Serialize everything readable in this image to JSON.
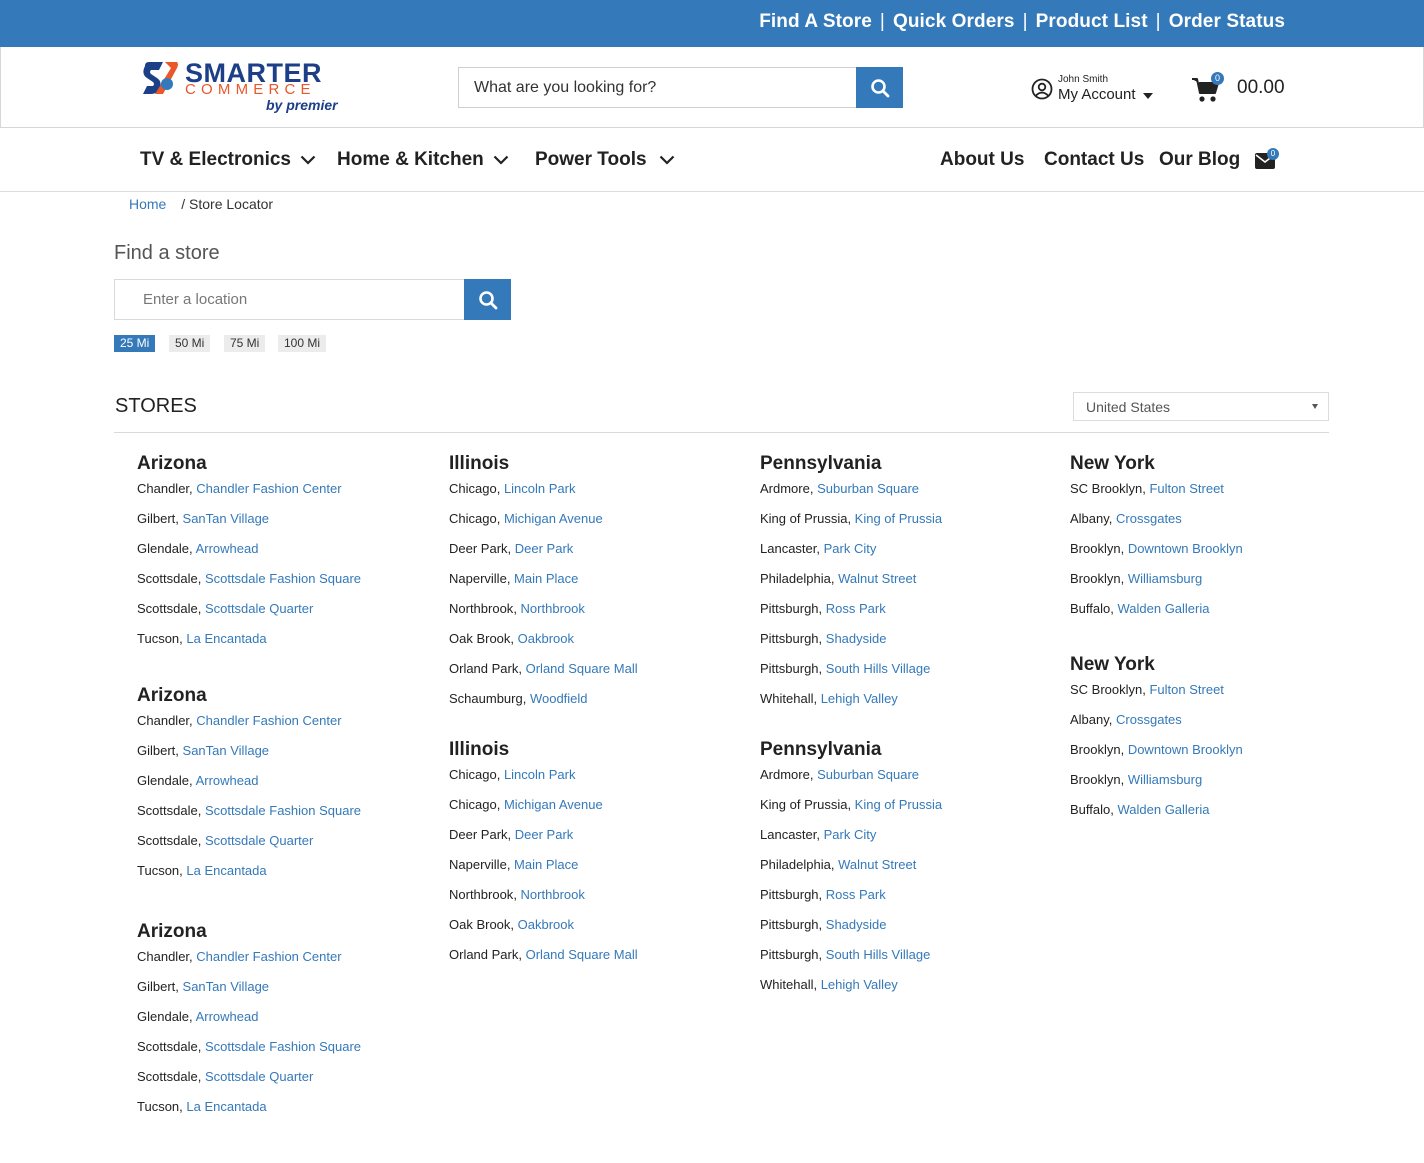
{
  "topbar": {
    "links": [
      "Find A Store",
      "Quick Orders",
      "Product List",
      "Order Status"
    ],
    "separator": "|"
  },
  "logo": {
    "word1": "SMARTER",
    "word2": "COMMERCE",
    "word3": "by premier"
  },
  "search": {
    "placeholder": "What are you looking for?"
  },
  "account": {
    "user_name": "John Smith",
    "label": "My Account"
  },
  "cart": {
    "count": "0",
    "total": "00.00"
  },
  "nav": {
    "menus": [
      "TV & Electronics",
      "Home & Kitchen",
      "Power Tools"
    ],
    "links": [
      "About Us",
      "Contact Us",
      "Our Blog"
    ],
    "mail_badge": "0"
  },
  "breadcrumb": {
    "home": "Home",
    "current": "/ Store Locator"
  },
  "finder": {
    "title": "Find a store",
    "placeholder": "Enter a location",
    "radii": [
      "25 Mi",
      "50 Mi",
      "75 Mi",
      "100 Mi"
    ],
    "active_radius": "25 Mi"
  },
  "stores": {
    "title": "STORES",
    "country": "United States",
    "groups": [
      {
        "state": "Arizona",
        "stores": [
          {
            "city": "Chandler",
            "name": "Chandler Fashion Center"
          },
          {
            "city": "Gilbert",
            "name": "SanTan Village"
          },
          {
            "city": "Glendale",
            "name": "Arrowhead"
          },
          {
            "city": "Scottsdale",
            "name": "Scottsdale Fashion Square"
          },
          {
            "city": "Scottsdale",
            "name": "Scottsdale Quarter"
          },
          {
            "city": "Tucson",
            "name": "La Encantada"
          }
        ]
      },
      {
        "state": "Arizona",
        "stores": [
          {
            "city": "Chandler",
            "name": "Chandler Fashion Center"
          },
          {
            "city": "Gilbert",
            "name": "SanTan Village"
          },
          {
            "city": "Glendale",
            "name": "Arrowhead"
          },
          {
            "city": "Scottsdale",
            "name": "Scottsdale Fashion Square"
          },
          {
            "city": "Scottsdale",
            "name": "Scottsdale Quarter"
          },
          {
            "city": "Tucson",
            "name": "La Encantada"
          }
        ]
      },
      {
        "state": "Arizona",
        "stores": [
          {
            "city": "Chandler",
            "name": "Chandler Fashion Center"
          },
          {
            "city": "Gilbert",
            "name": "SanTan Village"
          },
          {
            "city": "Glendale",
            "name": "Arrowhead"
          },
          {
            "city": "Scottsdale",
            "name": "Scottsdale Fashion Square"
          },
          {
            "city": "Scottsdale",
            "name": "Scottsdale Quarter"
          },
          {
            "city": "Tucson",
            "name": "La Encantada"
          }
        ]
      },
      {
        "state": "Illinois",
        "stores": [
          {
            "city": "Chicago",
            "name": "Lincoln Park"
          },
          {
            "city": "Chicago",
            "name": "Michigan Avenue"
          },
          {
            "city": "Deer Park",
            "name": "Deer Park"
          },
          {
            "city": "Naperville",
            "name": "Main Place"
          },
          {
            "city": "Northbrook",
            "name": "Northbrook"
          },
          {
            "city": "Oak Brook",
            "name": "Oakbrook"
          },
          {
            "city": "Orland Park",
            "name": "Orland Square Mall"
          },
          {
            "city": "Schaumburg",
            "name": "Woodfield"
          }
        ]
      },
      {
        "state": "Illinois",
        "stores": [
          {
            "city": "Chicago",
            "name": "Lincoln Park"
          },
          {
            "city": "Chicago",
            "name": "Michigan Avenue"
          },
          {
            "city": "Deer Park",
            "name": "Deer Park"
          },
          {
            "city": "Naperville",
            "name": "Main Place"
          },
          {
            "city": "Northbrook",
            "name": "Northbrook"
          },
          {
            "city": "Oak Brook",
            "name": "Oakbrook"
          },
          {
            "city": "Orland Park",
            "name": "Orland Square Mall"
          }
        ]
      },
      {
        "state": "Pennsylvania",
        "stores": [
          {
            "city": "Ardmore",
            "name": "Suburban Square"
          },
          {
            "city": "King of Prussia",
            "name": "King of Prussia"
          },
          {
            "city": "Lancaster",
            "name": "Park City"
          },
          {
            "city": "Philadelphia",
            "name": "Walnut Street"
          },
          {
            "city": "Pittsburgh",
            "name": "Ross Park"
          },
          {
            "city": "Pittsburgh",
            "name": "Shadyside"
          },
          {
            "city": "Pittsburgh",
            "name": "South Hills Village"
          },
          {
            "city": "Whitehall",
            "name": "Lehigh Valley"
          }
        ]
      },
      {
        "state": "Pennsylvania",
        "stores": [
          {
            "city": "Ardmore",
            "name": "Suburban Square"
          },
          {
            "city": "King of Prussia",
            "name": "King of Prussia"
          },
          {
            "city": "Lancaster",
            "name": "Park City"
          },
          {
            "city": "Philadelphia",
            "name": "Walnut Street"
          },
          {
            "city": "Pittsburgh",
            "name": "Ross Park"
          },
          {
            "city": "Pittsburgh",
            "name": "Shadyside"
          },
          {
            "city": "Pittsburgh",
            "name": "South Hills Village"
          },
          {
            "city": "Whitehall",
            "name": "Lehigh Valley"
          }
        ]
      },
      {
        "state": "New York",
        "stores": [
          {
            "city": "SC Brooklyn",
            "name": "Fulton Street"
          },
          {
            "city": "Albany",
            "name": "Crossgates"
          },
          {
            "city": "Brooklyn",
            "name": "Downtown Brooklyn"
          },
          {
            "city": "Brooklyn",
            "name": "Williamsburg"
          },
          {
            "city": "Buffalo",
            "name": "Walden Galleria"
          }
        ]
      },
      {
        "state": "New York",
        "stores": [
          {
            "city": "SC Brooklyn",
            "name": "Fulton Street"
          },
          {
            "city": "Albany",
            "name": "Crossgates"
          },
          {
            "city": "Brooklyn",
            "name": "Downtown Brooklyn"
          },
          {
            "city": "Brooklyn",
            "name": "Williamsburg"
          },
          {
            "city": "Buffalo",
            "name": "Walden Galleria"
          }
        ]
      }
    ]
  },
  "colors": {
    "brand": "#3479b9",
    "logo_navy": "#1c3f87",
    "logo_orange": "#e9572a"
  },
  "icons": [
    "search-icon",
    "user-circle-icon",
    "caret-down-icon",
    "cart-icon",
    "chevron-down-icon",
    "mail-icon"
  ]
}
